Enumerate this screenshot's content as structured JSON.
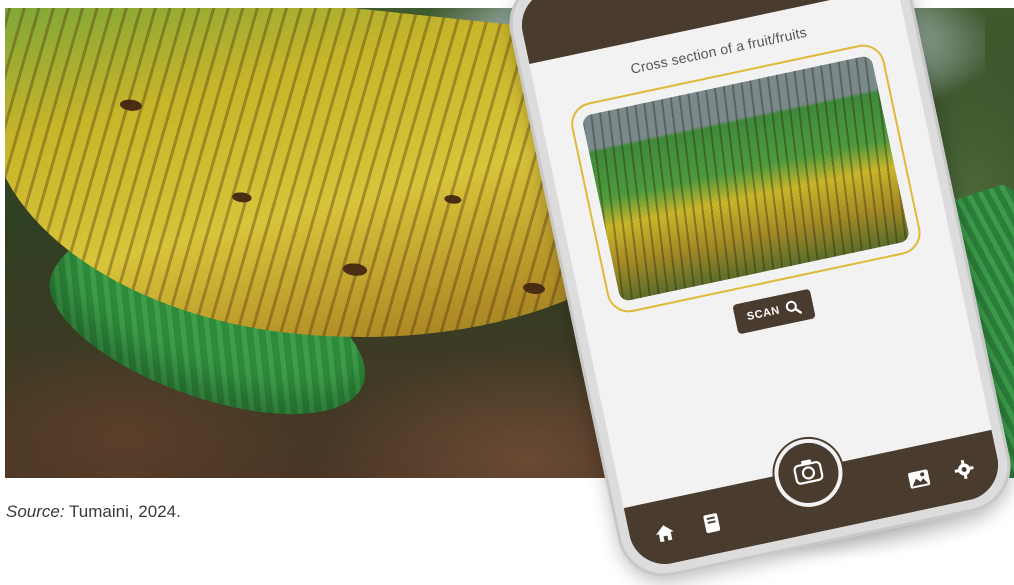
{
  "caption": {
    "source_label": "Source:",
    "source_text": " Tumaini, 2024."
  },
  "app": {
    "screen_title": "Cross section of a fruit/fruits",
    "scan_label": "SCAN",
    "nav": {
      "home_icon": "home-icon",
      "book_icon": "book-icon",
      "camera_icon": "camera-icon",
      "gallery_icon": "gallery-icon",
      "settings_icon": "gear-icon"
    }
  },
  "colors": {
    "bar": "#4a3b2f",
    "frame_highlight": "#e0b93a",
    "screen_bg": "#f2f2f2"
  }
}
